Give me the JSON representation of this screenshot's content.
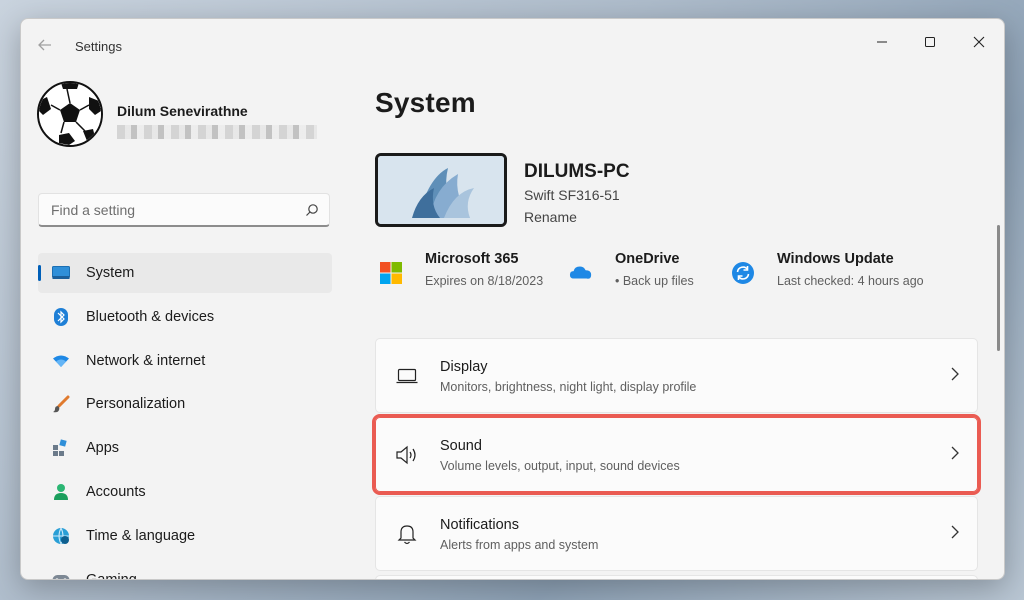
{
  "window": {
    "title": "Settings"
  },
  "profile": {
    "name": "Dilum Senevirathne"
  },
  "search": {
    "placeholder": "Find a setting"
  },
  "sidebar": {
    "items": [
      {
        "label": "System",
        "icon": "system-icon",
        "active": true
      },
      {
        "label": "Bluetooth & devices",
        "icon": "bluetooth-icon"
      },
      {
        "label": "Network & internet",
        "icon": "wifi-icon"
      },
      {
        "label": "Personalization",
        "icon": "brush-icon"
      },
      {
        "label": "Apps",
        "icon": "apps-icon"
      },
      {
        "label": "Accounts",
        "icon": "accounts-icon"
      },
      {
        "label": "Time & language",
        "icon": "globe-clock-icon"
      },
      {
        "label": "Gaming",
        "icon": "gamepad-icon"
      }
    ]
  },
  "main": {
    "title": "System",
    "device": {
      "name": "DILUMS-PC",
      "model": "Swift SF316-51",
      "rename": "Rename"
    },
    "quick": [
      {
        "title": "Microsoft 365",
        "sub": "Expires on 8/18/2023",
        "icon": "microsoft-logo-icon"
      },
      {
        "title": "OneDrive",
        "sub": "• Back up files",
        "icon": "onedrive-cloud-icon"
      },
      {
        "title": "Windows Update",
        "sub": "Last checked: 4 hours ago",
        "icon": "windows-update-icon"
      }
    ],
    "cards": [
      {
        "title": "Display",
        "sub": "Monitors, brightness, night light, display profile",
        "icon": "display-icon"
      },
      {
        "title": "Sound",
        "sub": "Volume levels, output, input, sound devices",
        "icon": "speaker-icon",
        "highlighted": true
      },
      {
        "title": "Notifications",
        "sub": "Alerts from apps and system",
        "icon": "bell-icon"
      }
    ]
  },
  "colors": {
    "accent": "#005fb8",
    "highlight": "#ea5b52"
  }
}
